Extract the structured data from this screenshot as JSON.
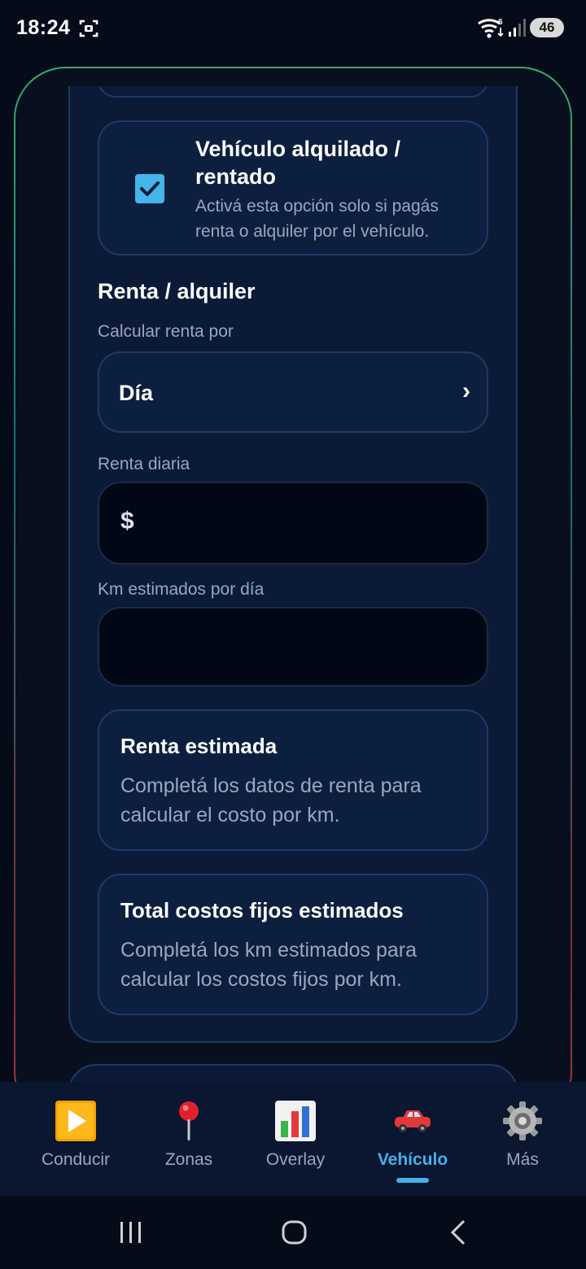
{
  "status_bar": {
    "time": "18:24",
    "battery": "46",
    "wifi_badge": "6"
  },
  "rent_toggle": {
    "checked": true,
    "title": "Vehículo alquilado / rentado",
    "description": "Activá esta opción solo si pagás renta o alquiler por el vehículo."
  },
  "rent_section": {
    "title": "Renta / alquiler",
    "calc_label": "Calcular renta por",
    "calc_value": "Día",
    "daily_label": "Renta diaria",
    "currency_symbol": "$",
    "daily_value": "",
    "km_label": "Km estimados por día",
    "km_value": ""
  },
  "estimated_rent": {
    "title": "Renta estimada",
    "text": "Completá los datos de renta para calcular el costo por km."
  },
  "fixed_costs": {
    "title": "Total costos fijos estimados",
    "text": "Completá los km estimados para calcular los costos fijos por km."
  },
  "bottom_nav": {
    "items": [
      {
        "label": "Conducir",
        "icon": "play-button-icon"
      },
      {
        "label": "Zonas",
        "icon": "map-pin-icon"
      },
      {
        "label": "Overlay",
        "icon": "bar-chart-icon"
      },
      {
        "label": "Vehículo",
        "icon": "car-icon",
        "active": true
      },
      {
        "label": "Más",
        "icon": "gear-icon"
      }
    ]
  },
  "colors": {
    "accent": "#44b2ea",
    "background": "#050b18",
    "card": "#0c1f3f",
    "muted_text": "#9aa7bd"
  }
}
